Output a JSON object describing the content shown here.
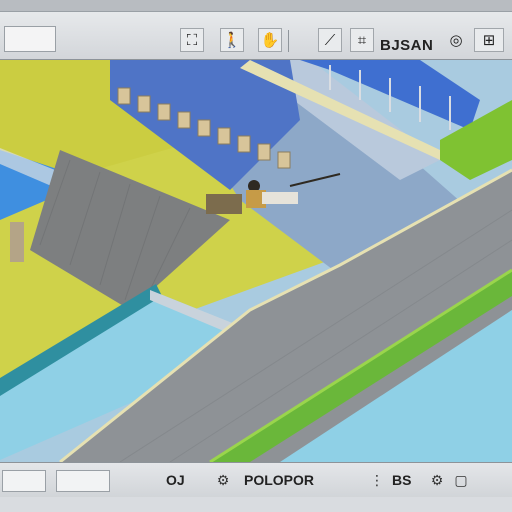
{
  "toolbar": {
    "label": "",
    "mode_readout": "BJSAN",
    "tools": [
      {
        "name": "select-tool",
        "icon": "⛶"
      },
      {
        "name": "walk-tool",
        "icon": "🚶"
      },
      {
        "name": "pan-tool",
        "icon": "✋"
      },
      {
        "name": "slope-tool",
        "icon": "⟋"
      },
      {
        "name": "section-tool",
        "icon": "⌗"
      },
      {
        "name": "grid-tool",
        "icon": "⊞"
      },
      {
        "name": "target-tool",
        "icon": "◎"
      }
    ]
  },
  "statusbar": {
    "left_label": "",
    "field_value": "",
    "text_a": "OJ",
    "text_b": "POLOPOR",
    "text_c": "BS"
  },
  "colors": {
    "lawn": "#cfd24a",
    "water": "#8fd0e6",
    "wall": "#8e9296",
    "roof_green": "#6ab73a",
    "glass": "#3f6fd0"
  }
}
